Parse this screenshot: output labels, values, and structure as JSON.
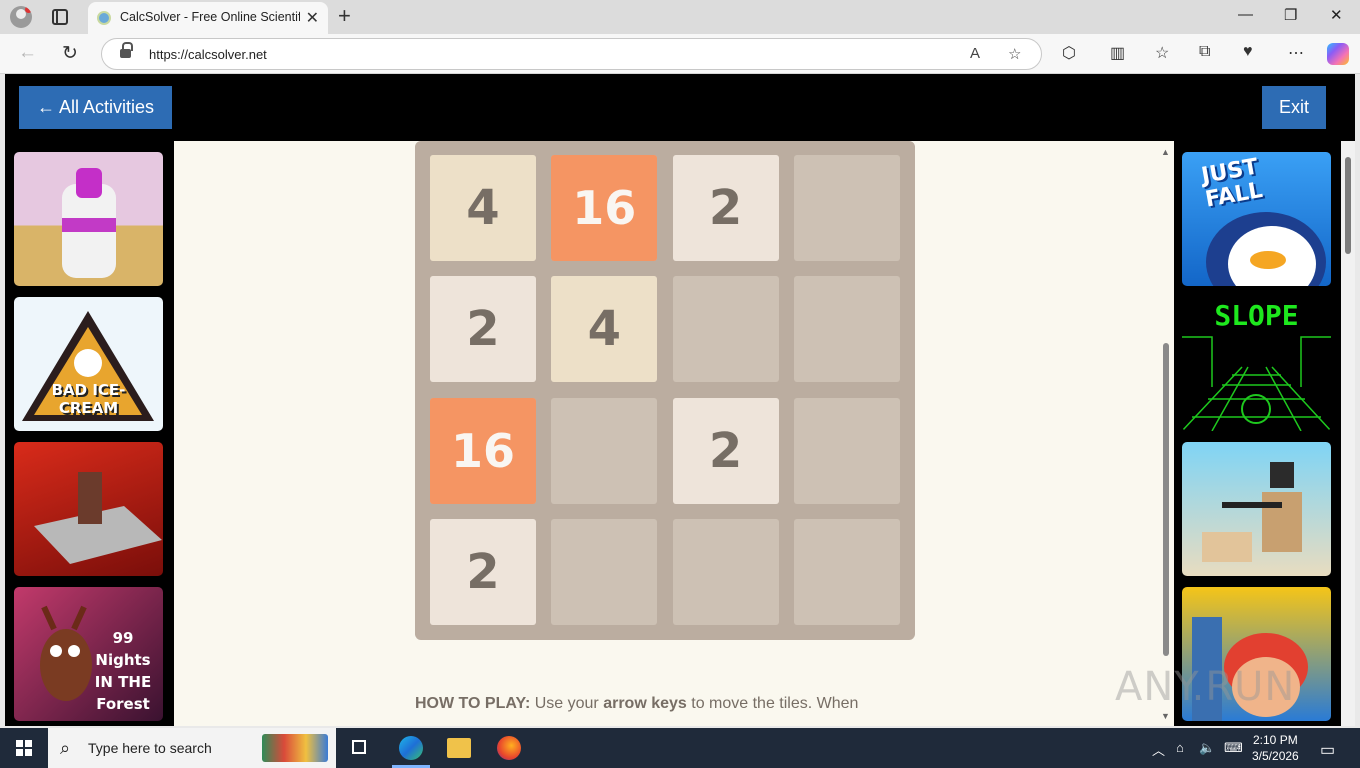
{
  "browser": {
    "tab_title": "CalcSolver - Free Online Scientific",
    "url": "https://calcsolver.net",
    "read_aloud_label": "A",
    "window_controls": [
      "—",
      "❐",
      "✕"
    ]
  },
  "page": {
    "back_button": "← All Activities",
    "exit_button": "Exit",
    "left_games": [
      {
        "name": "bottle-game",
        "label": ""
      },
      {
        "name": "bad-ice-cream",
        "label": "BAD ICE-CREAM"
      },
      {
        "name": "block-game",
        "label": ""
      },
      {
        "name": "99-nights-in-the-forest",
        "label": "99 Nights IN THE Forest"
      }
    ],
    "right_games": [
      {
        "name": "just-fall",
        "label": "JUST FALL"
      },
      {
        "name": "slope",
        "label": "SLOPE"
      },
      {
        "name": "shooter-game",
        "label": ""
      },
      {
        "name": "subway-surfers",
        "label": ""
      }
    ],
    "board": {
      "rows": [
        [
          "4",
          "16",
          "2",
          ""
        ],
        [
          "2",
          "4",
          "",
          ""
        ],
        [
          "16",
          "",
          "2",
          ""
        ],
        [
          "2",
          "",
          "",
          ""
        ]
      ]
    },
    "howto": {
      "lead": "HOW TO PLAY:",
      "text1": " Use your ",
      "keys": "arrow keys",
      "text2": " to move the tiles. When"
    }
  },
  "taskbar": {
    "search_placeholder": "Type here to search",
    "time": "2:10 PM",
    "date": "3/5/2026"
  },
  "watermark": "ANY.RUN"
}
